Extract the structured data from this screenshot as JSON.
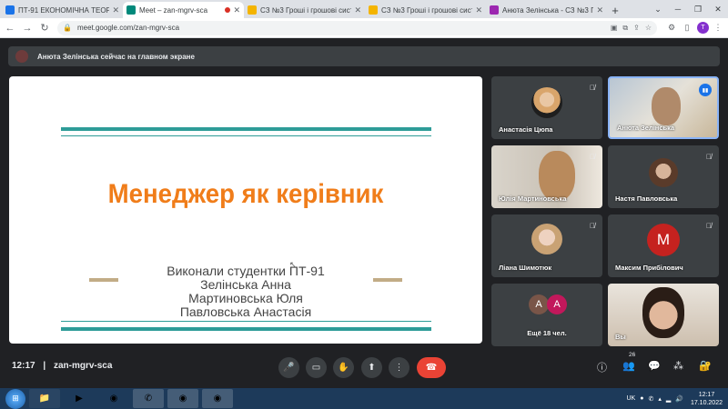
{
  "tabs": [
    {
      "title": "ПТ-91 ЕКОНОМІЧНА ТЕОРІЯ",
      "favicon_color": "#1a73e8",
      "active": false
    },
    {
      "title": "Meet – zan-mgrv-sca",
      "favicon_color": "#00897b",
      "active": true
    },
    {
      "title": "СЗ №3 Гроші і грошові систе",
      "favicon_color": "#f4b400",
      "active": false
    },
    {
      "title": "СЗ №3 Гроші і грошові систе",
      "favicon_color": "#f4b400",
      "active": false
    },
    {
      "title": "Анюта Зелінська - СЗ №3 Гр",
      "favicon_color": "#9c27b0",
      "active": false
    }
  ],
  "address_bar": {
    "url": "meet.google.com/zan-mgrv-sca"
  },
  "profile_initial": "T",
  "banner": {
    "text": "Анюта Зелінська сейчас на главном экране"
  },
  "slide": {
    "title": "Менеджер як керівник",
    "authors_heading": "Виконали студентки ПТ-91",
    "authors": [
      "Зелінська Анна",
      "Мартиновська Юля",
      "Павловська Анастасія"
    ]
  },
  "participants": [
    {
      "name": "Анастасія Цюпа",
      "muted": true
    },
    {
      "name": "Анюта Зелінська",
      "muted": false,
      "speaking": true
    },
    {
      "name": "Юлія Мартиновська",
      "muted": true
    },
    {
      "name": "Настя Павловська",
      "muted": true
    },
    {
      "name": "Ліана Шимотюк",
      "muted": true
    },
    {
      "name": "Максим Прибілович",
      "muted": true,
      "initial": "M"
    },
    {
      "name": "Ещё 18 чел.",
      "initials": [
        "A",
        "A"
      ]
    },
    {
      "name": "Вы"
    }
  ],
  "bottom": {
    "time": "12:17",
    "meeting_code": "zan-mgrv-sca",
    "participant_count": "26"
  },
  "taskbar": {
    "lang": "UK",
    "time": "12:17",
    "date": "17.10.2022"
  },
  "colors": {
    "slide_title": "#f07d1a",
    "slide_bar": "#2e9c98",
    "end_call": "#ea4335"
  }
}
